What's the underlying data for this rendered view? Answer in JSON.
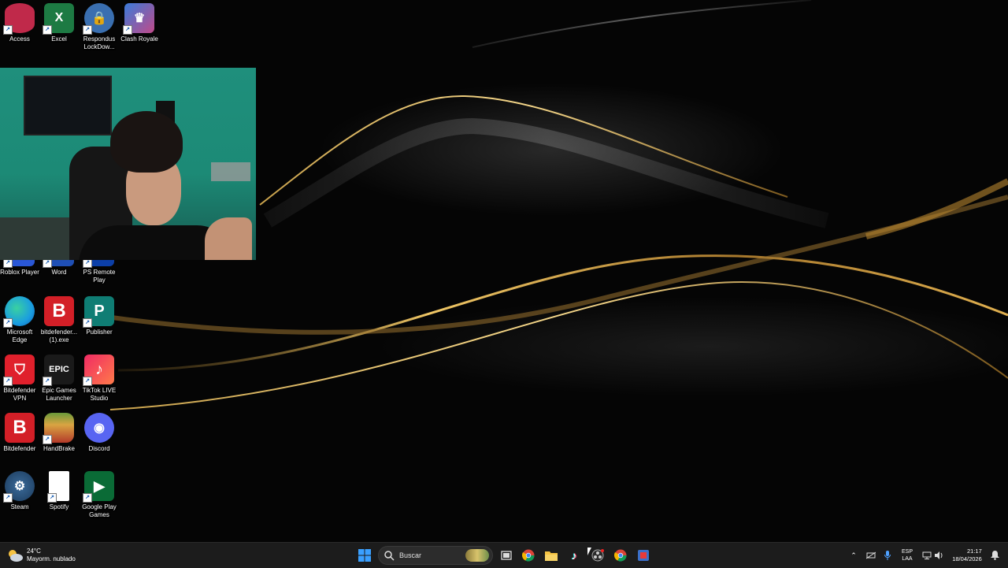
{
  "desktop": {
    "icons": [
      {
        "label": "Access",
        "icon": "access-icon",
        "color": "#c0294a"
      },
      {
        "label": "Excel",
        "icon": "excel-icon",
        "color": "#1d7a43"
      },
      {
        "label": "Respondus LockDow...",
        "icon": "respondus-lockdown-icon",
        "color": "#3a6fb0"
      },
      {
        "label": "Clash Royale",
        "icon": "clash-royale-icon",
        "color": "#3b7bd8"
      },
      {
        "label": "Roblox Player",
        "icon": "roblox-icon",
        "color": "#2a57d6"
      },
      {
        "label": "Word",
        "icon": "word-icon",
        "color": "#1f4fb5"
      },
      {
        "label": "PS Remote Play",
        "icon": "ps-remote-play-icon",
        "color": "#0c3fa8"
      },
      {
        "label": "Microsoft Edge",
        "icon": "edge-icon",
        "color": "#1a9de0"
      },
      {
        "label": "bitdefender... (1).exe",
        "icon": "bitdefender-installer-icon",
        "color": "#d31f27"
      },
      {
        "label": "Publisher",
        "icon": "publisher-icon",
        "color": "#0f7d74"
      },
      {
        "label": "Bitdefender VPN",
        "icon": "bitdefender-vpn-icon",
        "color": "#e0202c"
      },
      {
        "label": "Epic Games Launcher",
        "icon": "epic-games-icon",
        "color": "#1a1a1a"
      },
      {
        "label": "TikTok LIVE Studio",
        "icon": "tiktok-live-studio-icon",
        "color": "#f02b64"
      },
      {
        "label": "Bitdefender",
        "icon": "bitdefender-icon",
        "color": "#d31f27"
      },
      {
        "label": "HandBrake",
        "icon": "handbrake-icon",
        "color": "#b33a2a"
      },
      {
        "label": "Discord",
        "icon": "discord-icon",
        "color": "#5865f2"
      },
      {
        "label": "Steam",
        "icon": "steam-icon",
        "color": "#1b3a5c"
      },
      {
        "label": "Spotify",
        "icon": "spotify-file-icon",
        "color": "#ffffff"
      },
      {
        "label": "Google Play Games",
        "icon": "google-play-games-icon",
        "color": "#0a6b36"
      }
    ],
    "letters": {
      "bitdefender": "B",
      "bitdefender_exe": "B",
      "publisher": "P",
      "epic": "EPIC"
    }
  },
  "taskbar": {
    "weather": {
      "temp": "24°C",
      "condition": "Mayorm. nublado"
    },
    "search_placeholder": "Buscar",
    "pinned": [
      {
        "name": "start-button",
        "icon": "windows-start-icon"
      },
      {
        "name": "task-view-button",
        "icon": "task-view-icon"
      },
      {
        "name": "chrome-button",
        "icon": "chrome-icon"
      },
      {
        "name": "file-explorer-button",
        "icon": "folder-icon"
      },
      {
        "name": "tiktok-button",
        "icon": "tiktok-icon"
      },
      {
        "name": "obs-button",
        "icon": "obs-icon"
      },
      {
        "name": "chrome-profile-button",
        "icon": "chrome-icon"
      },
      {
        "name": "app-button",
        "icon": "app-icon"
      }
    ],
    "tray": {
      "lang_line1": "ESP",
      "lang_line2": "LAA",
      "time": "21:17",
      "date": "18/04/2026"
    }
  },
  "colors": {
    "taskbar_bg": "#1c1c1c",
    "accent": "#0a84ff",
    "gold": "#d8a33a"
  }
}
